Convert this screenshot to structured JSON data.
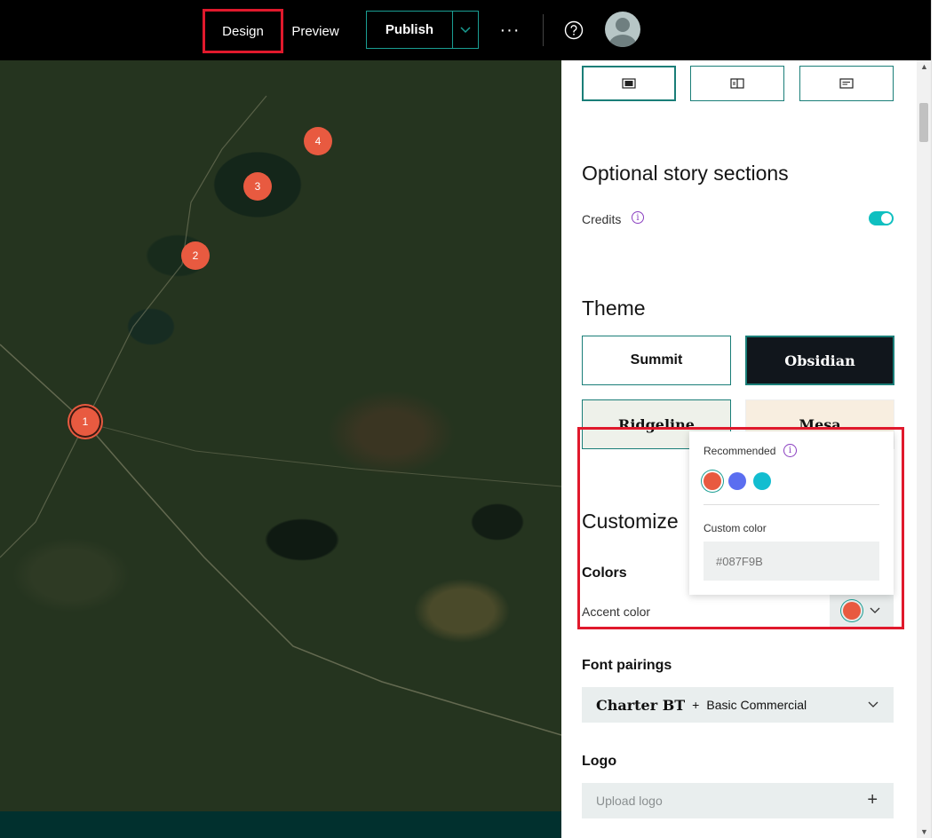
{
  "header": {
    "design_label": "Design",
    "preview_label": "Preview",
    "publish_label": "Publish",
    "more_label": "···",
    "help_icon": "help-circle-icon",
    "avatar_icon": "user-avatar-icon"
  },
  "map": {
    "markers": [
      "1",
      "2",
      "3",
      "4"
    ]
  },
  "panel": {
    "layout_icons": [
      "layout-full-icon",
      "layout-sidecar-icon",
      "layout-docked-icon"
    ],
    "optional_heading": "Optional story sections",
    "credits_label": "Credits",
    "credits_info": "i",
    "credits_enabled": true,
    "theme_heading": "Theme",
    "themes": [
      "Summit",
      "Obsidian",
      "Ridgeline",
      "Mesa"
    ],
    "selected_theme": "Obsidian",
    "customize_heading": "Customize",
    "colors_label": "Colors",
    "accent_label": "Accent color",
    "font_heading": "Font pairings",
    "font_primary": "Charter BT",
    "font_plus": "+",
    "font_secondary": "Basic Commercial",
    "logo_heading": "Logo",
    "logo_upload": "Upload logo",
    "logo_plus": "+"
  },
  "popover": {
    "recommended_label": "Recommended",
    "info": "i",
    "swatches": [
      "#e85a40",
      "#5b6ef0",
      "#12bdd0"
    ],
    "custom_label": "Custom color",
    "custom_placeholder": "#087F9B"
  },
  "colors": {
    "accent": "#e85a40",
    "teal": "#1a9e93",
    "highlight": "#e0192c"
  }
}
